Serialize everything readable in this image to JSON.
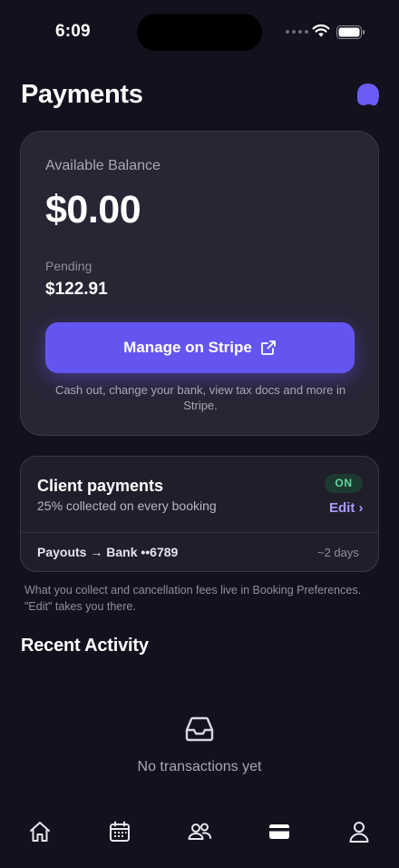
{
  "status_bar": {
    "time": "6:09",
    "icons": [
      "cellular-dots-icon",
      "wifi-icon",
      "battery-icon"
    ]
  },
  "header": {
    "title": "Payments",
    "avatar_icon": "avatar-blob-icon"
  },
  "balance": {
    "label": "Available Balance",
    "amount": "$0.00",
    "pending_label": "Pending",
    "pending_amount": "$122.91",
    "button_label": "Manage on Stripe",
    "button_icon": "external-link-icon",
    "note": "Cash out, change your bank, view tax docs and more in Stripe."
  },
  "client_payments": {
    "title": "Client payments",
    "subtitle": "25% collected on every booking",
    "status_badge": "ON",
    "edit_label": "Edit ›",
    "payouts_label": "Payouts → Bank ••6789",
    "payouts_eta": "~2 days"
  },
  "preferences_note": "What you collect and cancellation fees live in Booking Preferences. \"Edit\" takes you there.",
  "recent_activity": {
    "title": "Recent Activity",
    "empty_icon": "inbox-icon",
    "empty_text": "No transactions yet"
  },
  "tab_bar": {
    "tabs": [
      {
        "icon": "home-icon",
        "active": false
      },
      {
        "icon": "calendar-icon",
        "active": false
      },
      {
        "icon": "clients-icon",
        "active": false
      },
      {
        "icon": "card-icon",
        "active": true
      },
      {
        "icon": "profile-icon",
        "active": false
      }
    ]
  },
  "colors": {
    "background": "#14111f",
    "card": "#282535",
    "accent": "#6455f0",
    "accent_text": "#a99bf8",
    "on_badge_text": "#5fd69c"
  }
}
